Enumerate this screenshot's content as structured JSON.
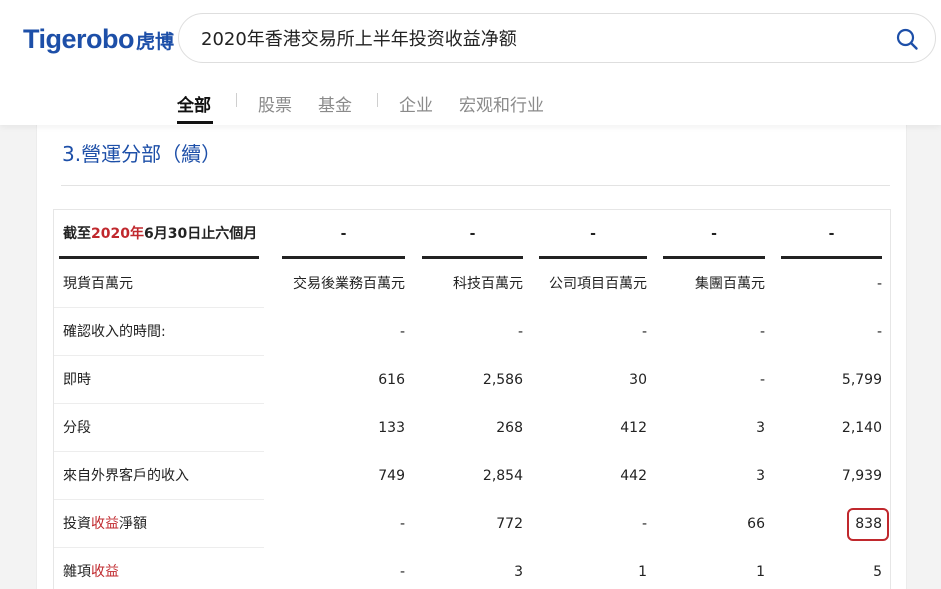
{
  "header": {
    "logo_en": "Tigerobo",
    "logo_cn": "虎博",
    "search_value": "2020年香港交易所上半年投资收益净额"
  },
  "tabs": [
    {
      "label": "全部",
      "active": true
    },
    {
      "label": "股票",
      "active": false
    },
    {
      "label": "基金",
      "active": false
    },
    {
      "label": "企业",
      "active": false
    },
    {
      "label": "宏观和行业",
      "active": false
    }
  ],
  "section": {
    "title": "3.營運分部（續）"
  },
  "table": {
    "header": {
      "period_prefix": "截至",
      "period_year": "2020年",
      "period_suffix": "6月30日止六個月",
      "columns": [
        "-",
        "-",
        "-",
        "-",
        "-"
      ]
    },
    "rows": [
      {
        "label": "現貨百萬元",
        "values": [
          "交易後業務百萬元",
          "科技百萬元",
          "公司項目百萬元",
          "集團百萬元",
          "-"
        ]
      },
      {
        "label": "確認收入的時間:",
        "values": [
          "-",
          "-",
          "-",
          "-",
          "-"
        ]
      },
      {
        "label": "即時",
        "values": [
          "616",
          "2,586",
          "30",
          "-",
          "5,799"
        ]
      },
      {
        "label": "分段",
        "values": [
          "133",
          "268",
          "412",
          "3",
          "2,140"
        ]
      },
      {
        "label": "來自外界客戶的收入",
        "values": [
          "749",
          "2,854",
          "442",
          "3",
          "7,939"
        ]
      },
      {
        "label_parts": [
          "投資",
          "收益",
          "淨額"
        ],
        "values": [
          "-",
          "772",
          "-",
          "66",
          "838"
        ]
      },
      {
        "label_parts": [
          "雜項",
          "收益"
        ],
        "values": [
          "-",
          "3",
          "1",
          "1",
          "5"
        ]
      }
    ]
  },
  "colors": {
    "brand": "#1d4fa8",
    "highlight": "#c0282d"
  }
}
